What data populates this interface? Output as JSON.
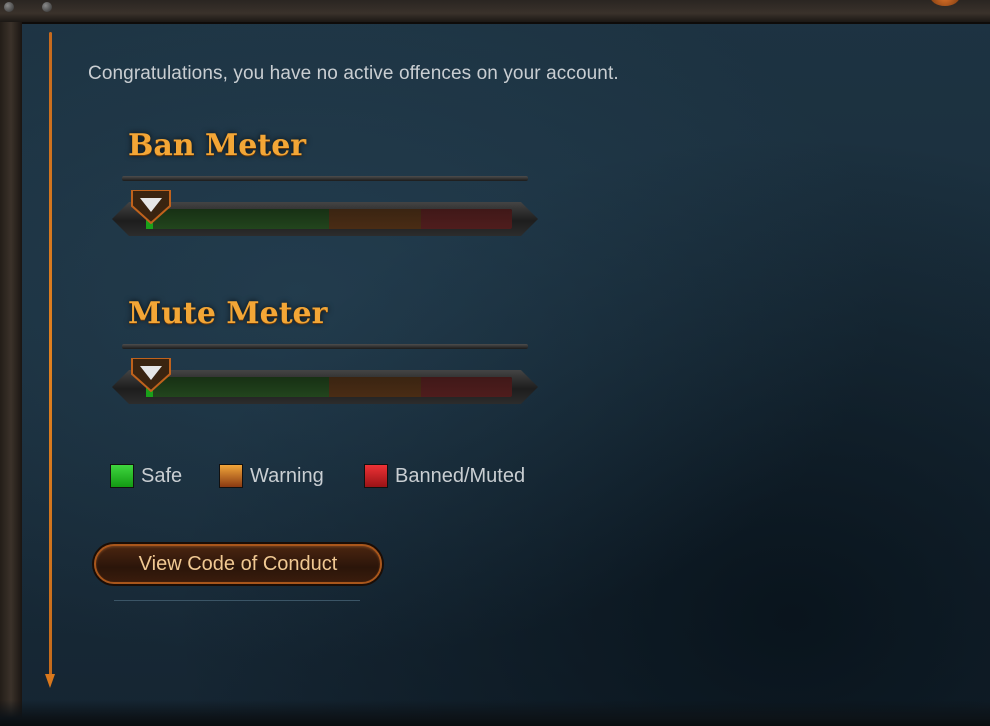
{
  "status_message": "Congratulations, you have no active offences on your account.",
  "meters": [
    {
      "title": "Ban Meter",
      "level": 0
    },
    {
      "title": "Mute Meter",
      "level": 0
    }
  ],
  "legend": [
    {
      "label": "Safe",
      "color": "#2cc22c"
    },
    {
      "label": "Warning",
      "color": "#e08a28"
    },
    {
      "label": "Banned/Muted",
      "color": "#d9262b"
    }
  ],
  "actions": {
    "code_of_conduct_label": "View Code of Conduct"
  },
  "colors": {
    "accent_orange": "#f3a636",
    "panel_bg": "#1a2b37",
    "meter_fill_safe": "#1aa01a"
  }
}
